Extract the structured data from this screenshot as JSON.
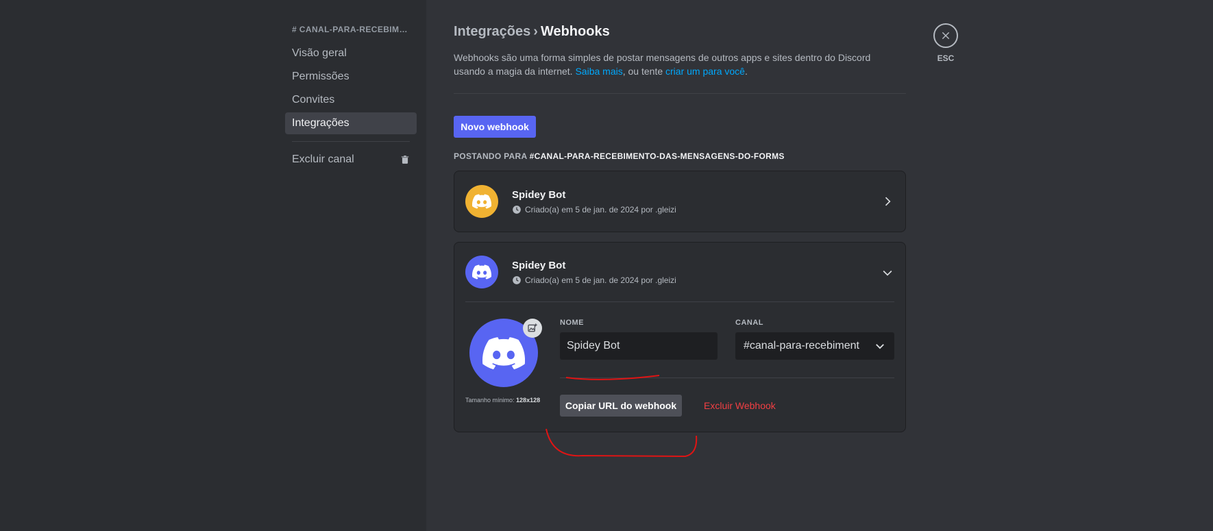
{
  "sidebar": {
    "header": "# CANAL-PARA-RECEBIME...",
    "items": [
      {
        "label": "Visão geral"
      },
      {
        "label": "Permissões"
      },
      {
        "label": "Convites"
      },
      {
        "label": "Integrações",
        "active": true
      }
    ],
    "delete_label": "Excluir canal"
  },
  "header": {
    "breadcrumb_parent": "Integrações",
    "breadcrumb_sep": "›",
    "breadcrumb_current": "Webhooks"
  },
  "description": {
    "text_before": "Webhooks são uma forma simples de postar mensagens de outros apps e sites dentro do Discord usando a magia da internet. ",
    "link1": "Saiba mais",
    "text_middle": ", ou tente ",
    "link2": "criar um para você",
    "text_after": "."
  },
  "new_webhook_button": "Novo webhook",
  "posting": {
    "prefix": "POSTANDO PARA",
    "channel": "#CANAL-PARA-RECEBIMENTO-DAS-MENSAGENS-DO-FORMS"
  },
  "webhooks": [
    {
      "name": "Spidey Bot",
      "meta": "Criado(a) em 5 de jan. de 2024 por .gleizi",
      "avatar_color": "#f0b232",
      "expanded": false
    },
    {
      "name": "Spidey Bot",
      "meta": "Criado(a) em 5 de jan. de 2024 por .gleizi",
      "avatar_color": "#5865f2",
      "expanded": true
    }
  ],
  "editor": {
    "min_size_prefix": "Tamanho mínimo:",
    "min_size_value": "128x128",
    "name_label": "NOME",
    "name_value": "Spidey Bot",
    "channel_label": "CANAL",
    "channel_value": "#canal-para-recebiment",
    "copy_url_button": "Copiar URL do webhook",
    "delete_link": "Excluir Webhook"
  },
  "close": {
    "label": "ESC",
    "icon": "close-icon"
  },
  "colors": {
    "accent": "#5865f2",
    "danger": "#f23f43",
    "link": "#00a8fc",
    "annotation": "#e01414"
  }
}
